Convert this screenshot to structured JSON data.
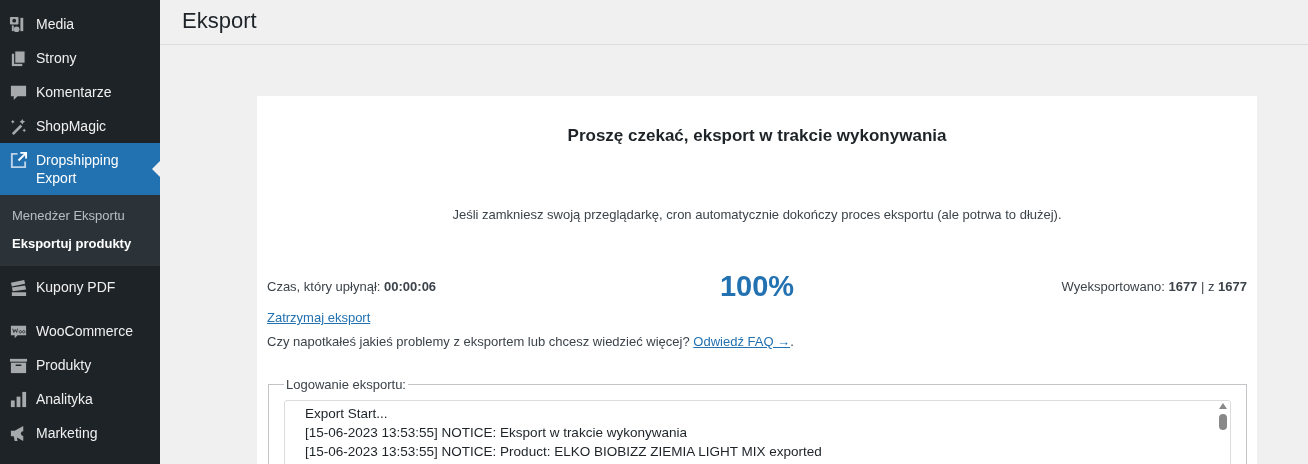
{
  "sidebar": {
    "items": [
      {
        "label": "Media",
        "selected": false
      },
      {
        "label": "Strony",
        "selected": false
      },
      {
        "label": "Komentarze",
        "selected": false
      },
      {
        "label": "ShopMagic",
        "selected": false
      },
      {
        "label": "Dropshipping Export",
        "selected": true,
        "children": [
          {
            "label": "Menedżer Eksportu",
            "selected": false
          },
          {
            "label": "Eksportuj produkty",
            "selected": true
          }
        ]
      },
      {
        "label": "Kupony PDF",
        "selected": false
      },
      {
        "label": "WooCommerce",
        "selected": false
      },
      {
        "label": "Produkty",
        "selected": false
      },
      {
        "label": "Analityka",
        "selected": false
      },
      {
        "label": "Marketing",
        "selected": false
      }
    ]
  },
  "page": {
    "title": "Eksport"
  },
  "export": {
    "heading": "Proszę czekać, eksport w trakcie wykonywania",
    "notice": "Jeśli zamkniesz swoją przeglądarkę, cron automatycznie dokończy proces eksportu (ale potrwa to dłużej).",
    "elapsed": "Czas, który upłynął: **00:00:06**",
    "percent": "100%",
    "exported": "Wyeksportowano: **1677** | z **1677**",
    "stop_link": "Zatrzymaj eksport",
    "faq_question": "Czy napotkałeś jakieś problemy z eksportem lub chcesz wiedzieć więcej?",
    "faq_link": "Odwiedź FAQ →",
    "faq_end": ".",
    "log_legend": "Logowanie eksportu:",
    "log_lines": [
      "Export Start...",
      "[15-06-2023 13:53:55] NOTICE: Eksport w trakcie wykonywania",
      "[15-06-2023 13:53:55] NOTICE: Product: ELKO BIOBIZZ ZIEMIA LIGHT MIX exported"
    ]
  }
}
